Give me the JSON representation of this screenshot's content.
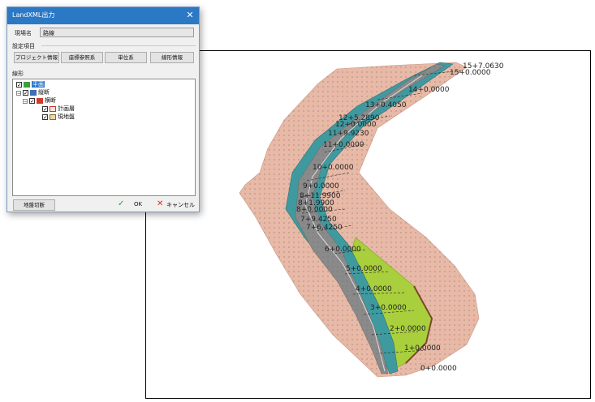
{
  "dialog": {
    "title": "LandXML出力",
    "close_glyph": "✕",
    "site_label": "現場名",
    "site_value": "路線",
    "settings_label": "設定項目",
    "buttons": {
      "project_info": "プロジェクト情報",
      "coord_system": "座標参照系",
      "unit_system": "単位系",
      "alignment_info": "線形情報"
    },
    "tree_label": "線形",
    "tree": {
      "root": "平面",
      "child1": "縦断",
      "child2": "横断",
      "leaf1": "計画層",
      "leaf2": "現地盤"
    },
    "footer": {
      "ground_cut": "地盤切断",
      "ok_icon": "✓",
      "ok": "OK",
      "cancel_icon": "✕",
      "cancel": "キャンセル"
    }
  },
  "viewport": {
    "stations": [
      {
        "label": "15+7.0630"
      },
      {
        "label": "15+0.0000"
      },
      {
        "label": "14+0.0000"
      },
      {
        "label": "13+0.4050"
      },
      {
        "label": "12+5.2890"
      },
      {
        "label": "12+0.0000"
      },
      {
        "label": "11+9.9230"
      },
      {
        "label": "11+0.0000"
      },
      {
        "label": "10+0.0000"
      },
      {
        "label": "9+0.0000"
      },
      {
        "label": "8+11.9900"
      },
      {
        "label": "8+1.9900"
      },
      {
        "label": "8+0.0000"
      },
      {
        "label": "7+9.4250"
      },
      {
        "label": "7+6.4250"
      },
      {
        "label": "6+0.0000"
      },
      {
        "label": "5+0.0000"
      },
      {
        "label": "4+0.0000"
      },
      {
        "label": "3+0.0000"
      },
      {
        "label": "2+0.0000"
      },
      {
        "label": "1+0.0000"
      },
      {
        "label": "0+0.0000"
      }
    ],
    "colors": {
      "terrain": "#e8b9a6",
      "cut_slope": "#3f9aa0",
      "road": "#8a8a8a",
      "grass": "#a9cf3c",
      "label": "#222222"
    }
  }
}
